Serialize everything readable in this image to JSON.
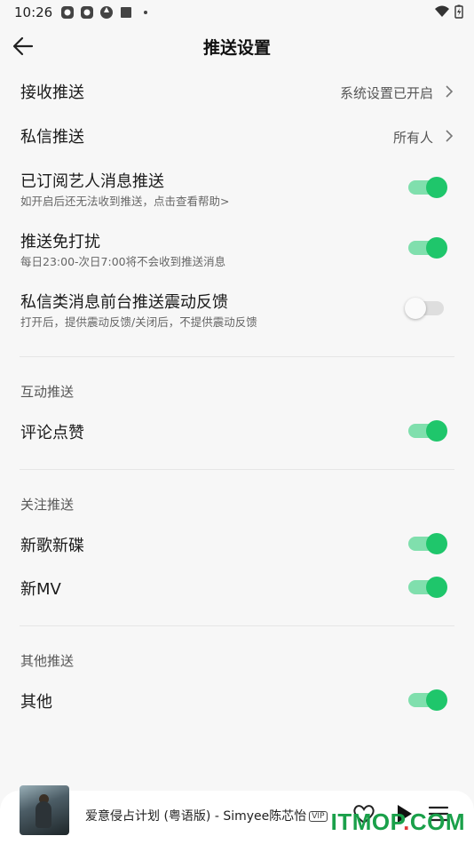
{
  "status_bar": {
    "time": "10:26"
  },
  "header": {
    "title": "推送设置"
  },
  "rows": [
    {
      "label": "接收推送",
      "value": "系统设置已开启"
    },
    {
      "label": "私信推送",
      "value": "所有人"
    },
    {
      "label": "已订阅艺人消息推送",
      "sub": "如开启后还无法收到推送，点击查看帮助>",
      "enabled": true
    },
    {
      "label": "推送免打扰",
      "sub": "每日23:00-次日7:00将不会收到推送消息",
      "enabled": true
    },
    {
      "label": "私信类消息前台推送震动反馈",
      "sub": "打开后，提供震动反馈/关闭后，不提供震动反馈",
      "enabled": false
    }
  ],
  "sections": [
    {
      "title": "互动推送",
      "items": [
        {
          "label": "评论点赞",
          "enabled": true
        }
      ]
    },
    {
      "title": "关注推送",
      "items": [
        {
          "label": "新歌新碟",
          "enabled": true
        },
        {
          "label": "新MV",
          "enabled": true
        }
      ]
    },
    {
      "title": "其他推送",
      "items": [
        {
          "label": "其他",
          "enabled": true
        }
      ]
    }
  ],
  "player": {
    "song": "爱意侵占计划 (粤语版) - Simyee陈芯怡",
    "badge": "VIP"
  },
  "watermark": {
    "prefix": "ITMOP",
    "dot": ".",
    "suffix": "COM"
  },
  "colors": {
    "accent": "#1fc66b",
    "track_on": "#80dfad",
    "track_off": "#dedede"
  }
}
